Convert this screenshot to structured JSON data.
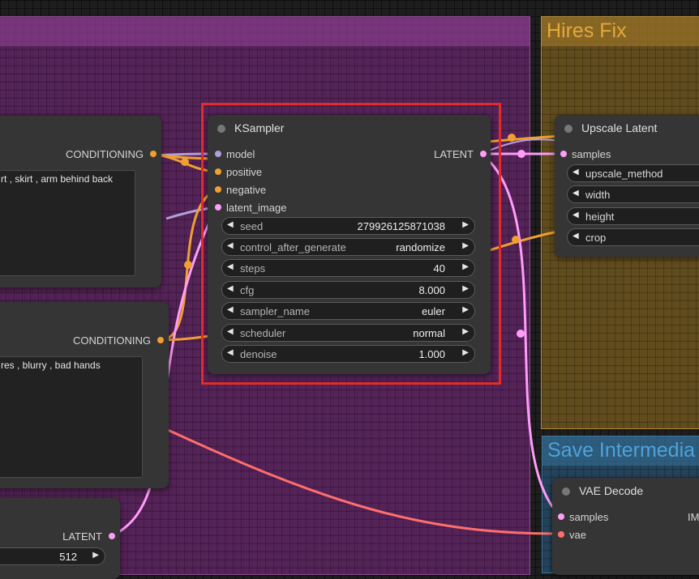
{
  "groups": {
    "purple": {
      "title": ""
    },
    "hires": {
      "title": "Hires Fix"
    },
    "save": {
      "title": "Save Intermedia"
    }
  },
  "nodes": {
    "positive_prompt": {
      "output_label": "CONDITIONING",
      "text": "rt , skirt , arm behind back"
    },
    "negative_prompt": {
      "output_label": "CONDITIONING",
      "text": "res , blurry , bad hands"
    },
    "latent_node": {
      "output_label": "LATENT",
      "widget_value": "512"
    },
    "ksampler": {
      "title": "KSampler",
      "inputs": [
        "model",
        "positive",
        "negative",
        "latent_image"
      ],
      "output_label": "LATENT",
      "widgets": [
        {
          "label": "seed",
          "value": "279926125871038"
        },
        {
          "label": "control_after_generate",
          "value": "randomize"
        },
        {
          "label": "steps",
          "value": "40"
        },
        {
          "label": "cfg",
          "value": "8.000"
        },
        {
          "label": "sampler_name",
          "value": "euler"
        },
        {
          "label": "scheduler",
          "value": "normal"
        },
        {
          "label": "denoise",
          "value": "1.000"
        }
      ]
    },
    "upscale_latent": {
      "title": "Upscale Latent",
      "input_label": "samples",
      "widgets": [
        "upscale_method",
        "width",
        "height",
        "crop"
      ]
    },
    "vae_decode": {
      "title": "VAE Decode",
      "inputs": [
        "samples",
        "vae"
      ],
      "output_label": "IM"
    }
  },
  "colors": {
    "conditioning": "#f0a030",
    "latent": "#ff9cf9",
    "model": "#b39ddb",
    "vae": "#ff6e6e",
    "highlight": "#e42b2b"
  }
}
